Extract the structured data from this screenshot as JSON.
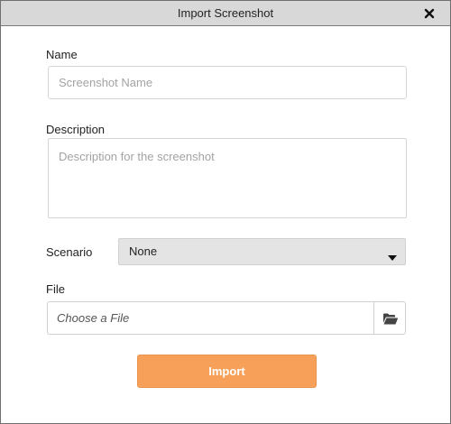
{
  "dialog": {
    "title": "Import Screenshot",
    "close_icon": "close-icon"
  },
  "form": {
    "name_label": "Name",
    "name_placeholder": "Screenshot Name",
    "name_value": "",
    "description_label": "Description",
    "description_placeholder": "Description for the screenshot",
    "description_value": "",
    "scenario_label": "Scenario",
    "scenario_selected": "None",
    "file_label": "File",
    "file_placeholder": "Choose a File",
    "file_value": "",
    "browse_icon": "folder-open-icon",
    "import_label": "Import"
  },
  "colors": {
    "titlebar_bg": "#d8d8d8",
    "import_button_bg": "#f6a05a",
    "select_bg": "#e4e4e4"
  }
}
